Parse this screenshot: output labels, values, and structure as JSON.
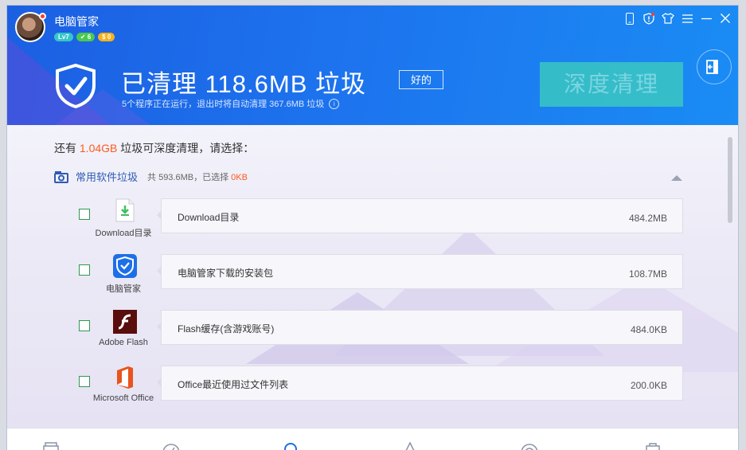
{
  "app": {
    "name": "电脑管家",
    "badges": [
      "Lv7",
      "✔ 6",
      "$ 0"
    ]
  },
  "header": {
    "title": "已清理 118.6MB 垃圾",
    "good_button": "好的",
    "subtitle": "5个程序正在运行，退出时将自动清理 367.6MB 垃圾",
    "deep_clean_button": "深度清理"
  },
  "colors": {
    "header_blue": "#1d73ee",
    "deep_clean_teal": "#3ac7c3",
    "highlight_orange": "#ff5a1f",
    "link_blue": "#2e5bb4"
  },
  "intro": {
    "prefix": "还有 ",
    "amount": "1.04GB",
    "suffix": " 垃圾可深度清理，请选择："
  },
  "category": {
    "name": "常用软件垃圾",
    "summary_prefix": "共 593.6MB，已选择 ",
    "selected": "0KB"
  },
  "items": [
    {
      "app_label": "Download目录",
      "name": "Download目录",
      "size": "484.2MB",
      "icon": "download-folder-icon"
    },
    {
      "app_label": "电脑管家",
      "name": "电脑管家下载的安装包",
      "size": "108.7MB",
      "icon": "tencent-pc-manager-icon"
    },
    {
      "app_label": "Adobe Flash",
      "name": "Flash缓存(含游戏账号)",
      "size": "484.0KB",
      "icon": "adobe-flash-icon"
    },
    {
      "app_label": "Microsoft Office",
      "name": "Office最近使用过文件列表",
      "size": "200.0KB",
      "icon": "microsoft-office-icon"
    }
  ]
}
